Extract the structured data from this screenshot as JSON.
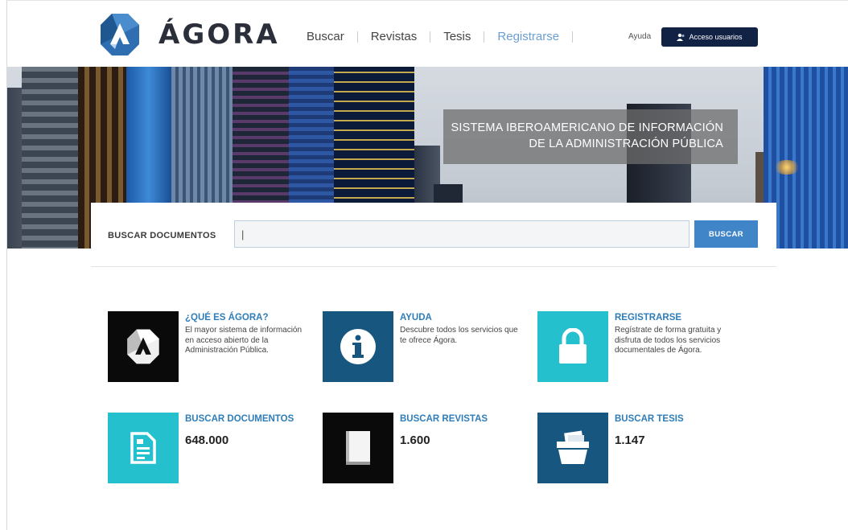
{
  "header": {
    "logo_text": "ÁGORA",
    "nav": [
      {
        "label": "Buscar"
      },
      {
        "label": "Revistas"
      },
      {
        "label": "Tesis"
      },
      {
        "label": "Registrarse"
      }
    ],
    "help_label": "Ayuda",
    "login_label": "Acceso usuarios"
  },
  "hero": {
    "title_line1": "SISTEMA IBEROAMERICANO DE INFORMACIÓN",
    "title_line2": "DE LA ADMINISTRACIÓN PÚBLICA"
  },
  "search": {
    "label": "BUSCAR DOCUMENTOS",
    "value": "|",
    "button_label": "BUSCAR"
  },
  "cards": [
    {
      "title": "¿QUÉ ES ÁGORA?",
      "desc": "El mayor sistema de información en acceso abierto de la Administración Pública.",
      "icon": "agora-logo-icon",
      "color": "#0a0a0a"
    },
    {
      "title": "AYUDA",
      "desc": "Descubre todos los servicios que te ofrece Ágora.",
      "icon": "info-icon",
      "color": "#17577f"
    },
    {
      "title": "REGISTRARSE",
      "desc": "Regístrate de forma gratuita y disfruta de todos los servicios documentales de Ágora.",
      "icon": "lock-icon",
      "color": "#25c0cd"
    },
    {
      "title": "BUSCAR DOCUMENTOS",
      "count": "648.000",
      "icon": "document-icon",
      "color": "#25c0cd"
    },
    {
      "title": "BUSCAR REVISTAS",
      "count": "1.600",
      "icon": "magazine-icon",
      "color": "#0a0a0a"
    },
    {
      "title": "BUSCAR TESIS",
      "count": "1.147",
      "icon": "folder-icon",
      "color": "#17577f"
    }
  ],
  "colors": {
    "brand_dark": "#122244",
    "accent_blue": "#3f85c8",
    "teal": "#25c0cd",
    "navy_tile": "#17577f"
  }
}
